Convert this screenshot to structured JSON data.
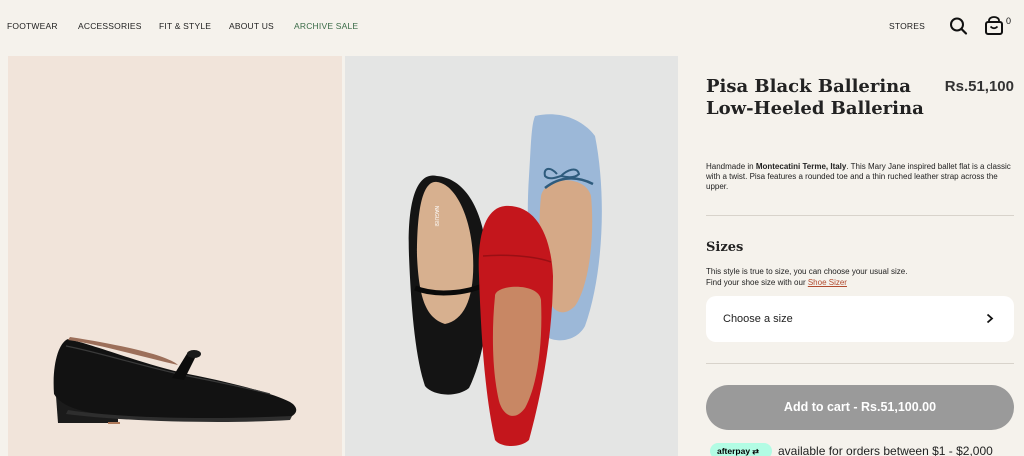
{
  "nav": {
    "items": [
      "FOOTWEAR",
      "ACCESSORIES",
      "FIT & STYLE",
      "ABOUT US",
      "ARCHIVE SALE"
    ],
    "stores": "STORES",
    "cart_count": "0"
  },
  "product": {
    "title": "Pisa Black Ballerina Low-Heeled Ballerina",
    "price": "Rs.51,100",
    "desc_prefix": "Handmade in ",
    "desc_place": "Montecatini Terme, Italy",
    "desc_suffix": ". This Mary Jane inspired ballet flat is a classic with a twist. Pisa features a rounded toe and a thin ruched leather strap across the upper.",
    "brand_mark": "NAGUISI"
  },
  "sizes": {
    "heading": "Sizes",
    "note_line1": "This style is true to size, you can choose your usual size.",
    "note_line2": "Find your shoe size with our ",
    "sizer_link": "Shoe Sizer",
    "select_label": "Choose a size"
  },
  "cart": {
    "button_label": "Add to cart - Rs.51,100.00"
  },
  "afterpay": {
    "badge": "afterpay",
    "text": "available for orders between $1 - $2,000"
  },
  "colors": {
    "accent_sale": "#3a6b47",
    "link": "#b14b2f",
    "button": "#9a9a9a",
    "afterpay": "#b2fce4"
  }
}
